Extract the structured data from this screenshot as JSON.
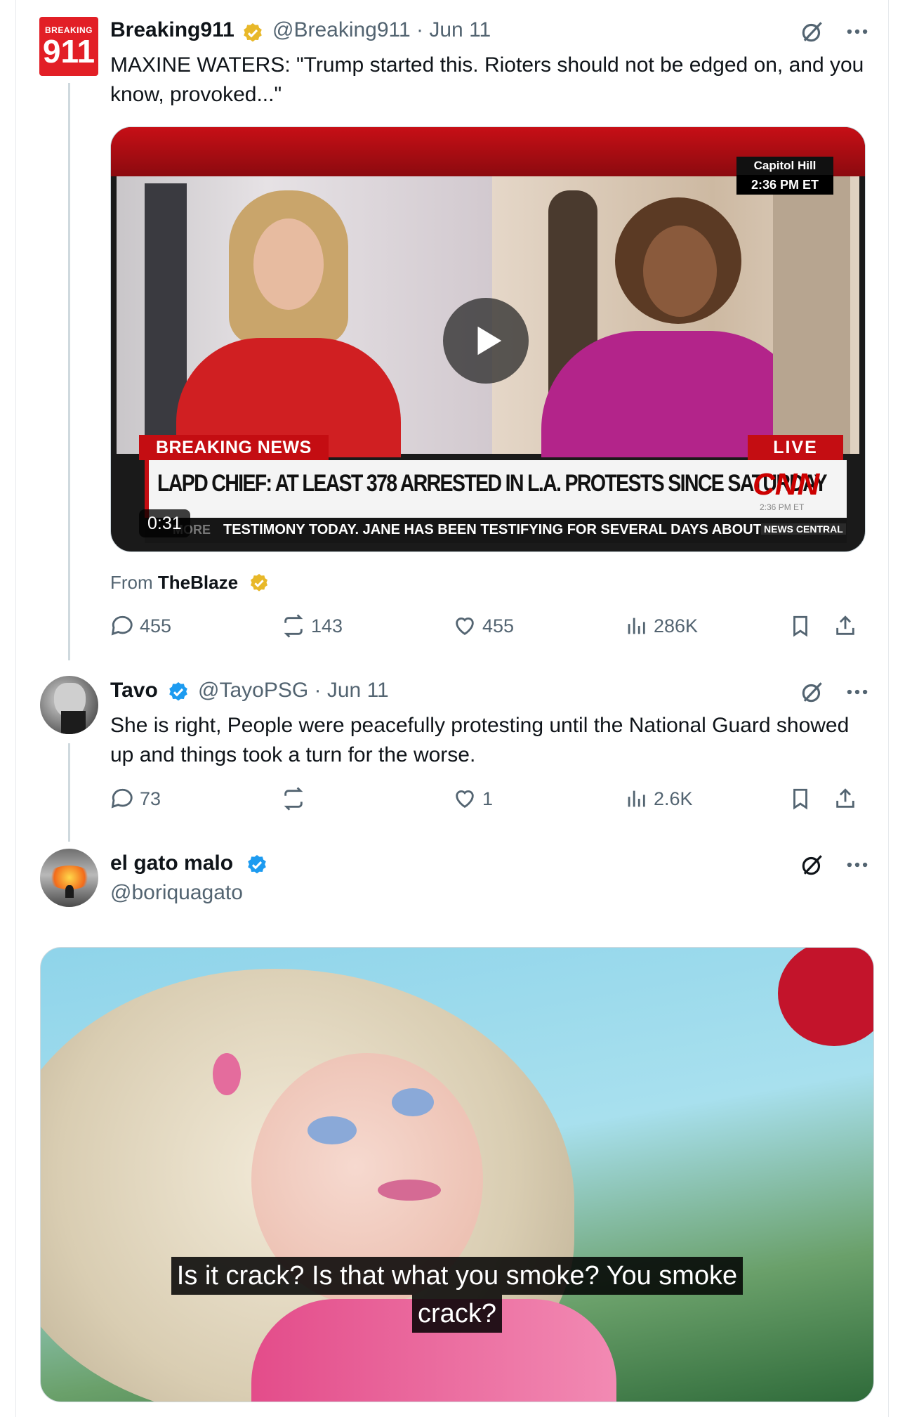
{
  "tweets": [
    {
      "logo": {
        "top": "BREAKING",
        "num": "911"
      },
      "name": "Breaking911",
      "handle": "@Breaking911",
      "date": "Jun 11",
      "text": "MAXINE WATERS: \"Trump started this. Rioters should not be edged on, and you know, provoked...\"",
      "video": {
        "location": "Capitol Hill",
        "time": "2:36 PM ET",
        "breaking": "BREAKING NEWS",
        "live": "LIVE",
        "headline": "LAPD CHIEF: AT LEAST 378 ARRESTED IN L.A. PROTESTS SINCE SATURDAY",
        "network": "CNN",
        "network_time": "2:36 PM ET",
        "ticker_lead": "MORE",
        "ticker": "TESTIMONY TODAY. JANE HAS BEEN TESTIFYING FOR SEVERAL DAYS ABOUT TH",
        "ticker_brand": "NEWS CENTRAL",
        "duration": "0:31"
      },
      "from_label": "From",
      "from_source": "TheBlaze",
      "replies": "455",
      "reposts": "143",
      "likes": "455",
      "views": "286K"
    },
    {
      "name": "Tavo",
      "handle": "@TayoPSG",
      "date": "Jun 11",
      "text": "She is right, People were peacefully protesting until the National Guard showed up and things took a turn for the worse.",
      "replies": "73",
      "reposts": "",
      "likes": "1",
      "views": "2.6K"
    },
    {
      "name": "el gato malo",
      "handle": "@boriquagato",
      "caption_line1": "Is it crack? Is that what you smoke? You smoke",
      "caption_line2": "crack?"
    }
  ],
  "colors": {
    "verified_gold": "#e8b829",
    "verified_blue": "#1d9bf0",
    "cnn_red": "#cc0000"
  },
  "icons": [
    "grok-icon",
    "more-icon",
    "reply-icon",
    "repost-icon",
    "like-icon",
    "views-icon",
    "bookmark-icon",
    "share-icon",
    "play-icon",
    "verified-badge"
  ]
}
